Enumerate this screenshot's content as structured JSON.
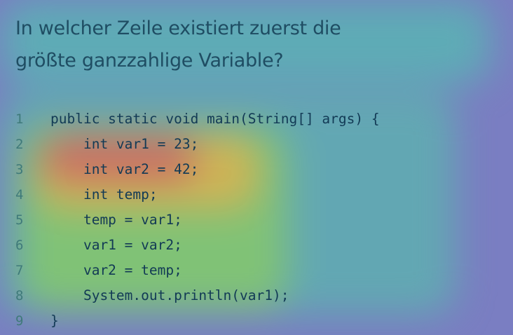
{
  "slide": {
    "question_lines": [
      "In welcher Zeile existiert zuerst die",
      "größte ganzzahlige Variable?"
    ],
    "code_lines": [
      {
        "number": "1",
        "text": "public static void main(String[] args) {"
      },
      {
        "number": "2",
        "text": "    int var1 = 23;"
      },
      {
        "number": "3",
        "text": "    int var2 = 42;"
      },
      {
        "number": "4",
        "text": "    int temp;"
      },
      {
        "number": "5",
        "text": "    temp = var1;"
      },
      {
        "number": "6",
        "text": "    var1 = var2;"
      },
      {
        "number": "7",
        "text": "    var2 = temp;"
      },
      {
        "number": "8",
        "text": "    System.out.println(var1);"
      },
      {
        "number": "9",
        "text": "}"
      }
    ]
  },
  "colors": {
    "background": "#7a7ec2",
    "title_text": "#1f4d63",
    "code_text": "#123a55",
    "line_number": "#3f7a7a",
    "heat_hot": "#c86a6a",
    "heat_warm": "#d7b44f",
    "heat_mild": "#8cc96a",
    "heat_cool": "#54b9b6"
  }
}
